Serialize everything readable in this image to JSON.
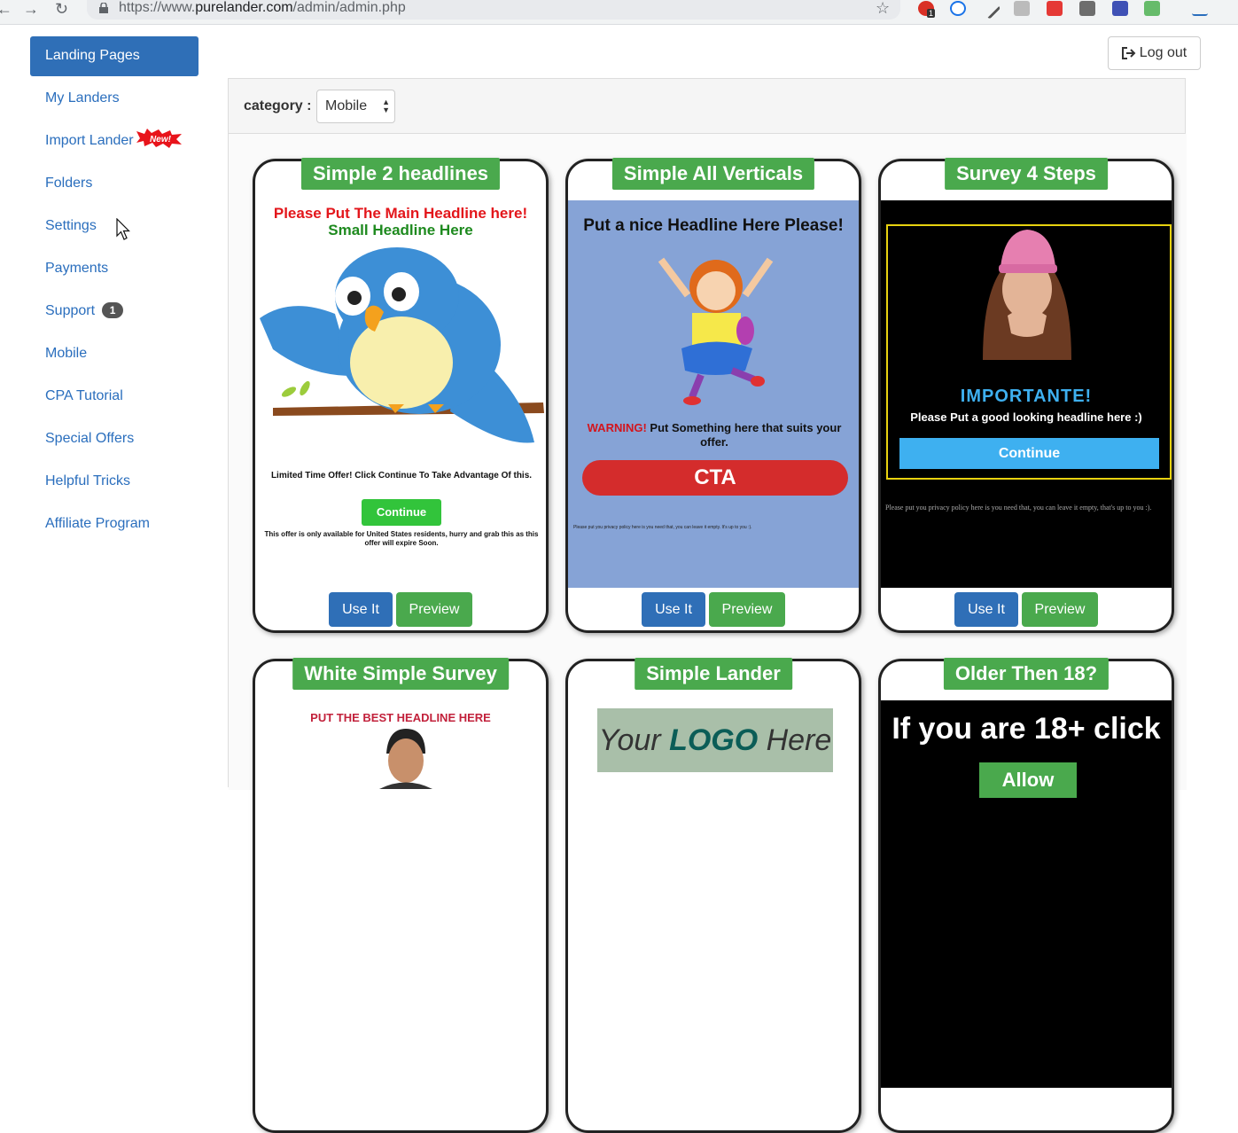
{
  "browser": {
    "url_prefix": "https://www.",
    "url_host": "purelander.com",
    "url_path": "/admin/admin.php",
    "ext_badge": "1"
  },
  "sidebar": {
    "items": [
      {
        "label": "Landing Pages"
      },
      {
        "label": "My Landers"
      },
      {
        "label": "Import Lander"
      },
      {
        "label": "Folders"
      },
      {
        "label": "Settings"
      },
      {
        "label": "Payments"
      },
      {
        "label": "Support"
      },
      {
        "label": "Mobile"
      },
      {
        "label": "CPA Tutorial"
      },
      {
        "label": "Special Offers"
      },
      {
        "label": "Helpful Tricks"
      },
      {
        "label": "Affiliate Program"
      }
    ],
    "new_badge": "New!",
    "support_count": "1"
  },
  "header": {
    "logout_label": "Log out"
  },
  "filter": {
    "category_label": "category :",
    "category_value": "Mobile"
  },
  "buttons": {
    "use": "Use It",
    "preview": "Preview"
  },
  "cards": [
    {
      "title": "Simple 2 headlines",
      "headline": "Please Put The Main Headline here!",
      "subheadline": "Small Headline Here",
      "offer_text": "Limited Time Offer! Click Continue To Take Advantage Of this.",
      "continue": "Continue",
      "fine_print": "This offer is only available for United States residents, hurry and grab this as this offer will expire Soon."
    },
    {
      "title": "Simple All Verticals",
      "headline": "Put a nice Headline Here Please!",
      "warning": "WARNING!",
      "warning_text": " Put Something here that suits your offer.",
      "cta": "CTA",
      "fine_print": "Please put you privacy policy here is you need that, you can leave it empty. It's up to you :)."
    },
    {
      "title": "Survey 4 Steps",
      "headline": "IMPORTANTE!",
      "subheadline": "Please Put a good looking headline here :)",
      "continue": "Continue",
      "fine_print": "Please put you privacy policy here is you need that, you can leave it empty, that's up to you :)."
    },
    {
      "title": "White Simple Survey",
      "headline": "PUT THE BEST HEADLINE HERE"
    },
    {
      "title": "Simple Lander",
      "logo_pre": "Your ",
      "logo_bold": "LOGO",
      "logo_post": " Here"
    },
    {
      "title": "Older Then 18?",
      "headline": "If you are 18+ click",
      "button": "Allow"
    }
  ],
  "colors": {
    "primary": "#2f6fb7",
    "success": "#4aa94d",
    "link": "#2a6ebd",
    "cta_red": "#d42c2c",
    "survey_blue": "#3eb0f0"
  }
}
